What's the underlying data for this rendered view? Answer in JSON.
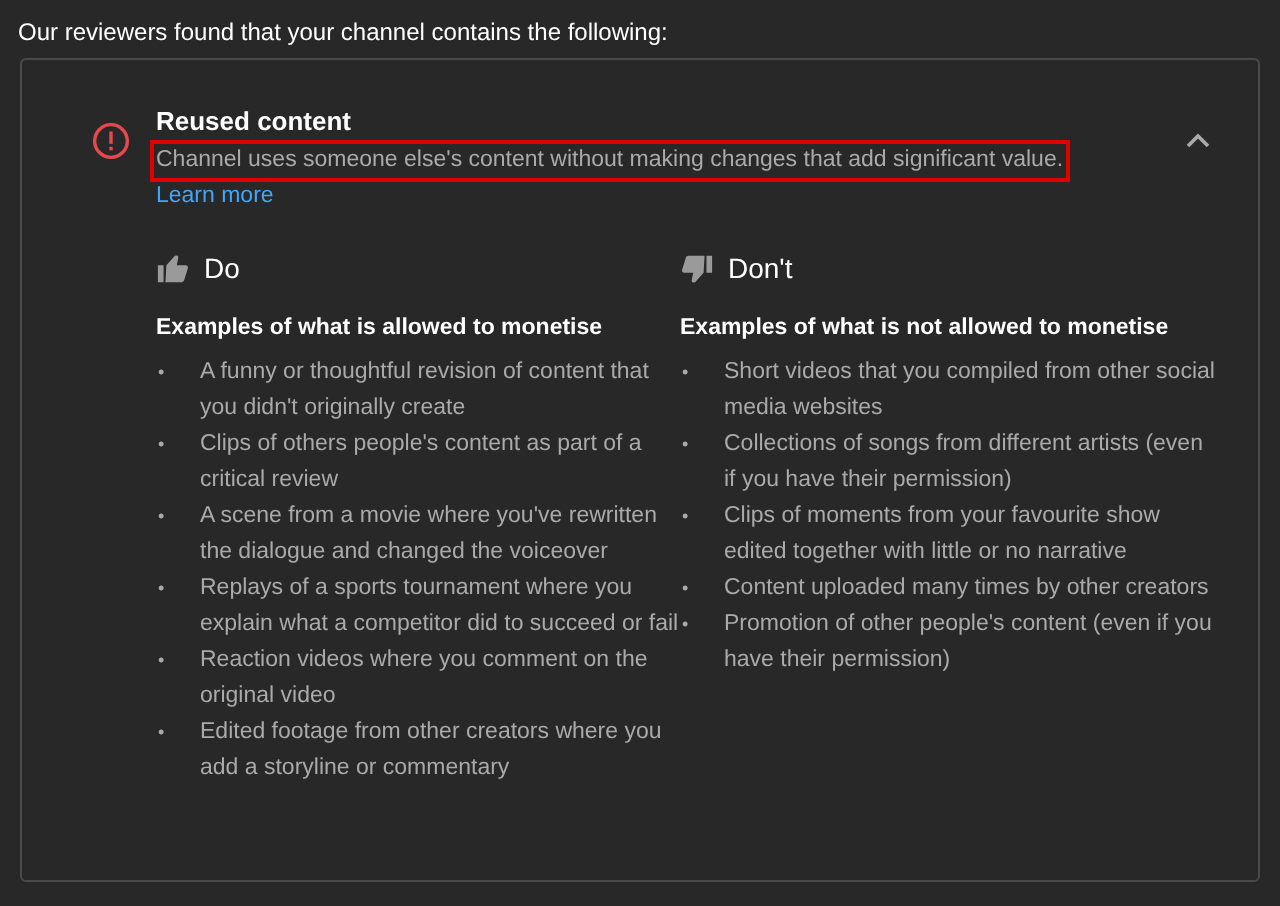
{
  "heading": "Our reviewers found that your channel contains the following:",
  "issue": {
    "title": "Reused content",
    "description": "Channel uses someone else's content without making changes that add significant value.",
    "highlighted": true,
    "link": "Learn more",
    "expanded": true
  },
  "columns": [
    {
      "kind": "do",
      "label": "Do",
      "subtitle": "Examples of what is allowed to monetise",
      "items": [
        {
          "bullet": "•",
          "text": "A funny or thoughtful revision of content that you didn't originally create"
        },
        {
          "bullet": "•",
          "text": "Clips of others people's content as part of a critical review"
        },
        {
          "bullet": "•",
          "text": "A scene from a movie where you've rewritten the dialogue and changed the voiceover"
        },
        {
          "bullet": "•",
          "text": "Replays of a sports tournament where you explain what a competitor did to succeed or fail"
        },
        {
          "bullet": "•",
          "text": "Reaction videos where you comment on the original video"
        },
        {
          "bullet": "•",
          "text": "Edited footage from other creators where you add a storyline or commentary"
        }
      ]
    },
    {
      "kind": "dont",
      "label": "Don't",
      "subtitle": "Examples of what is not allowed to monetise",
      "items": [
        {
          "bullet": "•",
          "text": "Short videos that you compiled from other social media websites"
        },
        {
          "bullet": "•",
          "text": "Collections of songs from different artists (even if you have their permission)"
        },
        {
          "bullet": "•",
          "text": "Clips of moments from your favourite show edited together with little or no narrative"
        },
        {
          "bullet": "•",
          "text": "Content uploaded many times by other creators"
        },
        {
          "bullet": "•",
          "text": "Promotion of other people's content (even if you have their permission)"
        }
      ]
    }
  ]
}
